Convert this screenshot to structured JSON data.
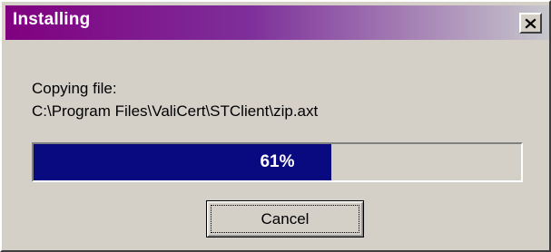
{
  "window": {
    "title": "Installing"
  },
  "close_button": {
    "icon": "close-icon"
  },
  "status": {
    "line1": "Copying file:",
    "line2": "C:\\Program Files\\ValiCert\\STClient\\zip.axt"
  },
  "progress": {
    "percent": 61,
    "label": "61%",
    "fill_color": "#0a0a80"
  },
  "cancel_button": {
    "label": "Cancel"
  },
  "colors": {
    "title_gradient_start": "#800080",
    "title_gradient_end": "#c7c7cc",
    "face": "#d4d0c8"
  }
}
